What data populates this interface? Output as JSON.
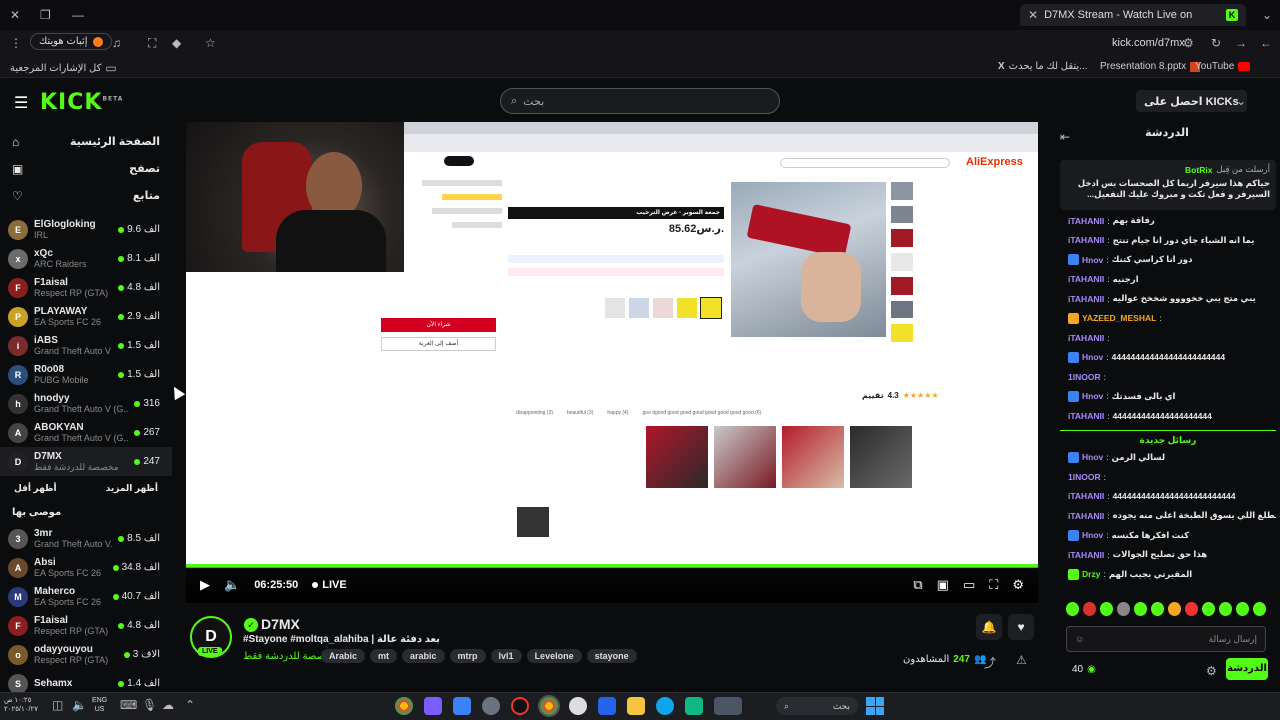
{
  "browser": {
    "tab_title": "D7MX Stream - Watch Live on",
    "url": "kick.com/d7mx",
    "extension_label": "إثبات هويتك",
    "bookmarks_all": "كل الإشارات المرجعية",
    "bookmark_items": [
      "يتقل لك ما يحدث...",
      "Presentation 8.pptx",
      "YouTube"
    ]
  },
  "header": {
    "logo": "KICK",
    "logo_sup": "BETA",
    "search_placeholder": "بحث",
    "get_kicks": "احصل على KICKs"
  },
  "sidebar": {
    "nav": [
      {
        "label": "الصفحة الرئيسية",
        "icon": "home-icon"
      },
      {
        "label": "تصفح",
        "icon": "browse-icon"
      },
      {
        "label": "متابع",
        "icon": "heart-icon"
      }
    ],
    "channels": [
      {
        "name": "ElGlogloking",
        "cat": "IRL",
        "viewers": "9.6 الف",
        "color": "#8a6d3b"
      },
      {
        "name": "xQc",
        "cat": "ARC Raiders",
        "viewers": "8.1 الف",
        "color": "#6b6b6b"
      },
      {
        "name": "F1aisal",
        "cat": "Respect RP (GTA)",
        "viewers": "4.8 الف",
        "color": "#8b1e1e"
      },
      {
        "name": "PLAYAWAY",
        "cat": "EA Sports FC 26",
        "viewers": "2.9 الف",
        "color": "#c9a227"
      },
      {
        "name": "iABS",
        "cat": "Grand Theft Auto V ...",
        "viewers": "1.5 الف",
        "color": "#7a2b2b"
      },
      {
        "name": "R0o08",
        "cat": "PUBG Mobile",
        "viewers": "1.5 الف",
        "color": "#2b4f7a"
      },
      {
        "name": "hnodyy",
        "cat": "Grand Theft Auto V (G...",
        "viewers": "316",
        "color": "#333"
      },
      {
        "name": "ABOKYAN",
        "cat": "Grand Theft Auto V (G...",
        "viewers": "267",
        "color": "#444"
      },
      {
        "name": "D7MX",
        "cat": "مخصصة للدردشة فقط",
        "viewers": "247",
        "color": "#222"
      }
    ],
    "show_more": "أظهر المزيد",
    "show_less": "أظهر أقل",
    "recommended_title": "موصى بها",
    "recommended": [
      {
        "name": "3mr",
        "cat": "Grand Theft Auto V...",
        "viewers": "8.5 الف",
        "color": "#555"
      },
      {
        "name": "Absi",
        "cat": "EA Sports FC 26",
        "viewers": "34.8 الف",
        "color": "#6b4a2b"
      },
      {
        "name": "Maherco",
        "cat": "EA Sports FC 26",
        "viewers": "40.7 الف",
        "color": "#2b3a7a"
      },
      {
        "name": "F1aisal",
        "cat": "Respect RP (GTA)",
        "viewers": "4.8 الف",
        "color": "#8b1e1e"
      },
      {
        "name": "odayyouyou",
        "cat": "Respect RP (GTA)",
        "viewers": "3 الاف",
        "color": "#7a5a2b"
      },
      {
        "name": "Sehamx",
        "cat": "",
        "viewers": "1.4 الف",
        "color": "#555"
      }
    ]
  },
  "video": {
    "aliexpress_logo": "AliExpress",
    "price": "85.62ر.س.",
    "product_title": "جمعة السوبر - عرض الترحيب",
    "buy_now": "شراء الآن",
    "add_to_cart": "أضف إلى العربة",
    "rating": "4.3",
    "rating_label": "تقييم",
    "review_tags": [
      "disappointing (3)",
      "beautiful (3)",
      "happy (4)",
      "goo dgood good good good good good good good (6)"
    ],
    "time": "06:25:50",
    "live_label": "LIVE"
  },
  "stream": {
    "avatar_text": "D",
    "live_badge": "LIVE",
    "name": "D7MX",
    "title": "#Stayone #moltqa_alahiba | بعد دفئة عالة",
    "category": "مخصصة للدردشة فقط",
    "tags": [
      "Arabic",
      "mt",
      "arabic",
      "mtrp",
      "lvl1",
      "Levelone",
      "stayone"
    ],
    "viewers_label": "المشاهدون",
    "viewers": "247"
  },
  "chat": {
    "title": "الدردشة",
    "pinned_sender_prefix": "أرسلت من قِبل",
    "pinned_sender": "BotRix",
    "pinned_text": "حياكم هذا سيرفر اربما كل الصحسات بس ادخل السيرفر و فعل تكت و مبروك عليك التفعيل...",
    "messages": [
      {
        "user": "iTAHANII",
        "text": "رفاقة بهم",
        "badge": ""
      },
      {
        "user": "iTAHANII",
        "text": "يما انه الشباء جاي دور انا جيام تنتج",
        "badge": ""
      },
      {
        "user": "Hnov",
        "text": "دور انا كراسي كتنك",
        "badge": "b"
      },
      {
        "user": "iTAHANII",
        "text": "ارجنيه",
        "badge": ""
      },
      {
        "user": "iTAHANII",
        "text": "يبي متج يبي خخوووو شخخخ عواليه",
        "badge": ""
      },
      {
        "user": "YAZEED_MESHAL",
        "text": "",
        "badge": "y"
      },
      {
        "user": "iTAHANII",
        "text": "",
        "badge": ""
      },
      {
        "user": "Hnov",
        "text": "444444444444444444444444",
        "badge": "b"
      },
      {
        "user": "1INOOR",
        "text": "",
        "badge": ""
      },
      {
        "user": "Hnov",
        "text": "اي بالى فسدتك",
        "badge": "b"
      },
      {
        "user": "iTAHANII",
        "text": "444444444444444444444",
        "badge": ""
      }
    ],
    "new_messages": "رسائل جديدة",
    "messages2": [
      {
        "user": "Hnov",
        "text": "لسالي الرمن",
        "badge": "b"
      },
      {
        "user": "1INOOR",
        "text": "",
        "badge": ""
      },
      {
        "user": "iTAHANII",
        "text": "44444444444444444444444444",
        "badge": ""
      },
      {
        "user": "iTAHANII",
        "text": "و اخر شي يطلع اللي يسوق الطبخة اعلى منه يجوده",
        "badge": ""
      },
      {
        "user": "Hnov",
        "text": "كنت افكرها مكنسه",
        "badge": "b"
      },
      {
        "user": "iTAHANII",
        "text": "هذا حق تصليح الجوالات",
        "badge": ""
      },
      {
        "user": "Drzy",
        "text": "المقيرتي بجيب الهم",
        "badge": "g"
      }
    ],
    "input_placeholder": "إرسال رسالة",
    "send_button": "الدردشة",
    "kicks_count": "40"
  },
  "taskbar": {
    "search_label": "بحث",
    "lang_top": "ENG",
    "lang_bottom": "US",
    "clock_time": "١٠:٢٥ ص",
    "clock_date": "٢٠٢٥/١٠/٢٧"
  },
  "colors": {
    "kick_green": "#53fc18",
    "background": "#0b0c0e",
    "aliexpress_red": "#e62e04"
  }
}
